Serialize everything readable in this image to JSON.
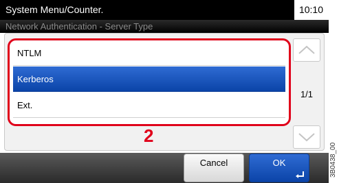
{
  "header": {
    "title": "System Menu/Counter.",
    "time": "10:10",
    "subtitle": "Network Authentication - Server Type"
  },
  "list": {
    "items": [
      {
        "label": "NTLM",
        "selected": false
      },
      {
        "label": "Kerberos",
        "selected": true
      },
      {
        "label": "Ext.",
        "selected": false
      }
    ],
    "page_indicator": "1/1"
  },
  "annotation": {
    "step_number": "2"
  },
  "footer": {
    "cancel_label": "Cancel",
    "ok_label": "OK"
  },
  "figure_code": "3B0438_00",
  "colors": {
    "highlight_red": "#e0001a",
    "selection_blue": "#0b44a8"
  },
  "icons": {
    "scroll_up": "chevron-up-icon",
    "scroll_down": "chevron-down-icon",
    "enter": "enter-icon"
  }
}
